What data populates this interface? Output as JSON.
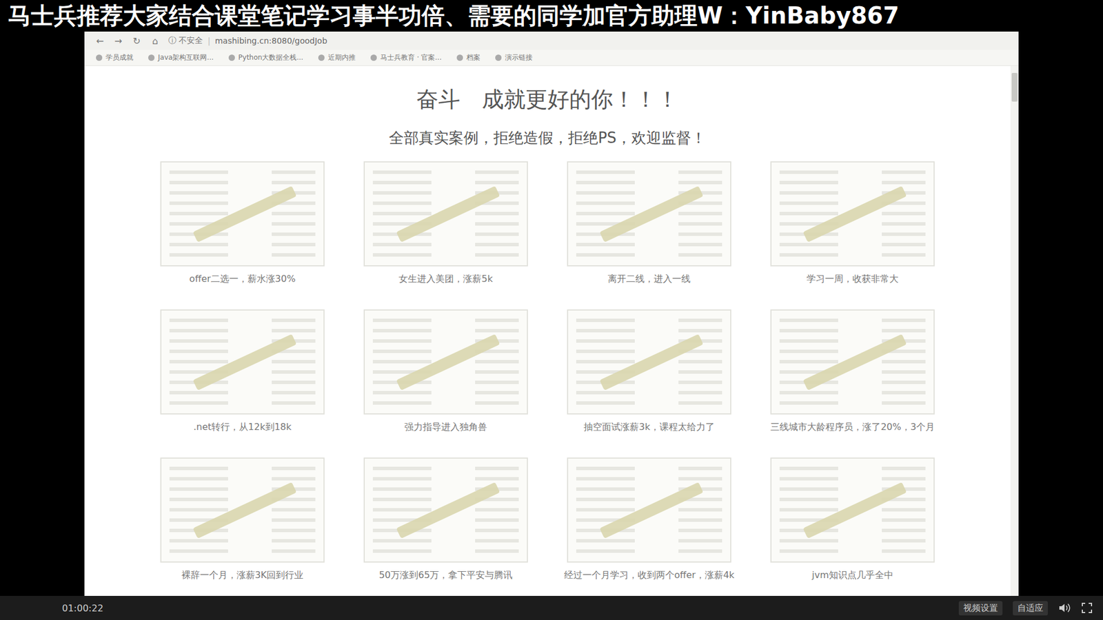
{
  "banner": {
    "text": "马士兵推荐大家结合课堂笔记学习事半功倍、需要的同学加官方助理W：YinBaby867"
  },
  "browser": {
    "nav_icons": [
      "←",
      "→",
      "↻",
      "⌂"
    ],
    "security": "不安全",
    "url": "mashibing.cn:8080/goodJob",
    "bookmarks": [
      "学员成就",
      "Java架构互联网...",
      "Python大数据全栈...",
      "近期内推",
      "马士兵教育 · 官案...",
      "档案",
      "演示链接"
    ]
  },
  "page": {
    "title": "奋斗　成就更好的你！！！",
    "subtitle": "全部真实案例，拒绝造假，拒绝PS，欢迎监督！",
    "cards": [
      {
        "caption": "offer二选一，薪水涨30%"
      },
      {
        "caption": "女生进入美团，涨薪5k"
      },
      {
        "caption": "离开二线，进入一线"
      },
      {
        "caption": "学习一周，收获非常大"
      },
      {
        "caption": ".net转行，从12k到18k"
      },
      {
        "caption": "强力指导进入独角兽"
      },
      {
        "caption": "抽空面试涨薪3k，课程太给力了"
      },
      {
        "caption": "三线城市大龄程序员，涨了20%，3个月"
      },
      {
        "caption": "裸辞一个月，涨薪3K回到行业"
      },
      {
        "caption": "50万涨到65万，拿下平安与腾讯"
      },
      {
        "caption": "经过一个月学习，收到两个offer，涨薪4k"
      },
      {
        "caption": "jvm知识点几乎全中"
      }
    ]
  },
  "player": {
    "time": "01:00:22",
    "buttons": [
      "视频设置",
      "自适应"
    ]
  }
}
